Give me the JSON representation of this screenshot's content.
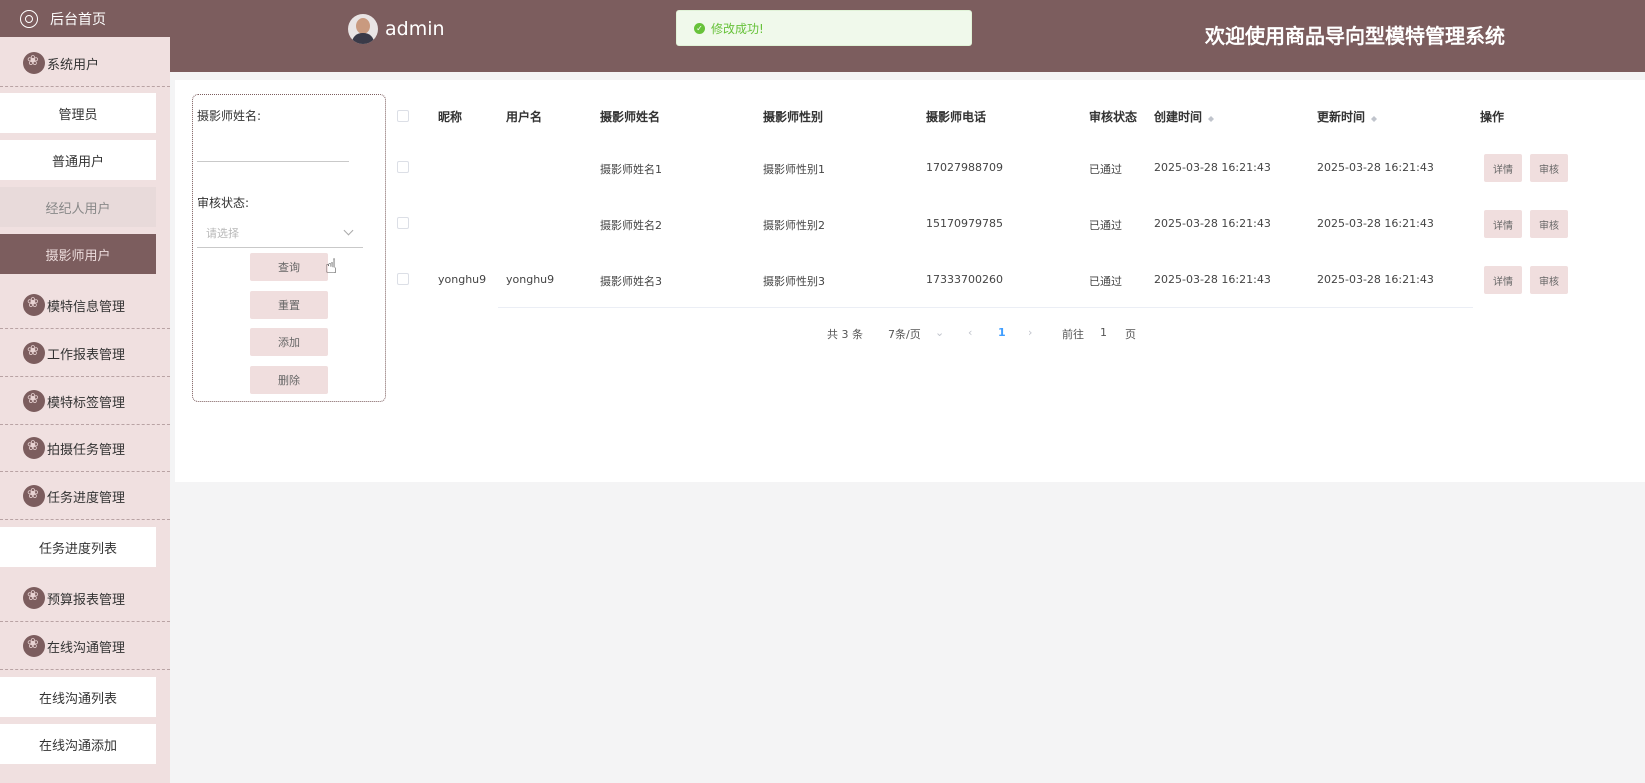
{
  "sidebar": {
    "home": "后台首页",
    "groups": [
      {
        "label": "系统用户",
        "items": [
          "管理员",
          "普通用户",
          "经纪人用户",
          "摄影师用户"
        ]
      },
      {
        "label": "模特信息管理"
      },
      {
        "label": "工作报表管理"
      },
      {
        "label": "模特标签管理"
      },
      {
        "label": "拍摄任务管理"
      },
      {
        "label": "任务进度管理",
        "items": [
          "任务进度列表"
        ]
      },
      {
        "label": "预算报表管理"
      },
      {
        "label": "在线沟通管理",
        "items": [
          "在线沟通列表",
          "在线沟通添加"
        ]
      }
    ]
  },
  "header": {
    "username": "admin",
    "title": "欢迎使用商品导向型模特管理系统"
  },
  "toast": {
    "message": "修改成功!"
  },
  "search": {
    "name_label": "摄影师姓名:",
    "status_label": "审核状态:",
    "status_placeholder": "请选择",
    "buttons": {
      "query": "查询",
      "reset": "重置",
      "add": "添加",
      "delete": "删除"
    }
  },
  "table": {
    "columns": [
      "昵称",
      "用户名",
      "摄影师姓名",
      "摄影师性别",
      "摄影师电话",
      "审核状态",
      "创建时间",
      "更新时间",
      "操作"
    ],
    "rows": [
      {
        "nickname": "",
        "username": "",
        "name": "摄影师姓名1",
        "gender": "摄影师性别1",
        "phone": "17027988709",
        "status": "已通过",
        "created": "2025-03-28 16:21:43",
        "updated": "2025-03-28 16:21:43"
      },
      {
        "nickname": "",
        "username": "",
        "name": "摄影师姓名2",
        "gender": "摄影师性别2",
        "phone": "15170979785",
        "status": "已通过",
        "created": "2025-03-28 16:21:43",
        "updated": "2025-03-28 16:21:43"
      },
      {
        "nickname": "yonghu9",
        "username": "yonghu9",
        "name": "摄影师姓名3",
        "gender": "摄影师性别3",
        "phone": "17333700260",
        "status": "已通过",
        "created": "2025-03-28 16:21:43",
        "updated": "2025-03-28 16:21:43"
      }
    ],
    "actions": {
      "detail": "详情",
      "review": "审核"
    }
  },
  "pagination": {
    "total": "共 3 条",
    "page_size": "7条/页",
    "current": "1",
    "goto_prefix": "前往",
    "goto_value": "1",
    "goto_suffix": "页"
  },
  "colors": {
    "brand": "#7c5d5e",
    "sidebar_bg": "#f0e0e0",
    "button_bg": "#f0dede",
    "success": "#67c23a",
    "link": "#409eff"
  }
}
